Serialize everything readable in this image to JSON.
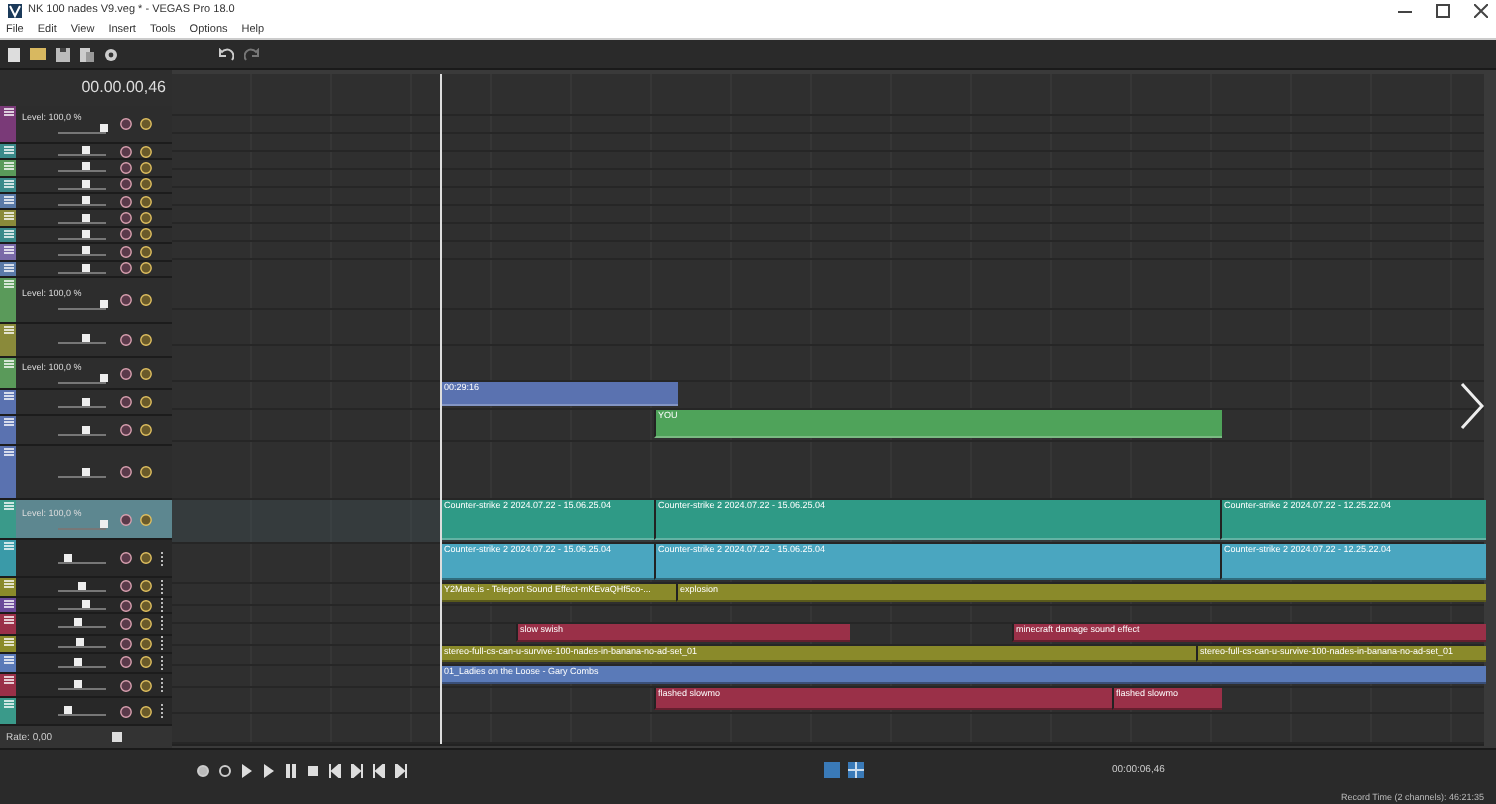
{
  "window": {
    "title": "NK 100 nades V9.veg * - VEGAS Pro 18.0"
  },
  "menu": [
    "File",
    "Edit",
    "View",
    "Insert",
    "Tools",
    "Options",
    "Help"
  ],
  "timecode": "00.00.00,46",
  "tracks": [
    {
      "kind": "video",
      "color": "#7a3a78",
      "level_text": "Level: 100,0 %",
      "level": 0.95,
      "selected": false
    },
    {
      "kind": "video",
      "color": "#3a8a8a",
      "level": 0.6,
      "selected": false
    },
    {
      "kind": "video",
      "color": "#5a9a5a",
      "level": 0.6,
      "selected": false
    },
    {
      "kind": "video",
      "color": "#3a8a8a",
      "level": 0.6,
      "selected": false
    },
    {
      "kind": "video",
      "color": "#5a7aa8",
      "level": 0.6,
      "selected": false
    },
    {
      "kind": "video",
      "color": "#8a8a3a",
      "level": 0.6,
      "selected": false
    },
    {
      "kind": "video",
      "color": "#3a8a8a",
      "level": 0.6,
      "selected": false
    },
    {
      "kind": "video",
      "color": "#7a6aa8",
      "level": 0.6,
      "selected": false
    },
    {
      "kind": "video",
      "color": "#5a7aa8",
      "level": 0.6,
      "selected": false
    },
    {
      "kind": "video",
      "color": "#5a9a5a",
      "level_text": "Level: 100,0 %",
      "level": 0.95,
      "selected": false
    },
    {
      "kind": "video",
      "color": "#8a8a3a",
      "level": 0.6,
      "selected": false
    },
    {
      "kind": "video",
      "color": "#5a9a5a",
      "level_text": "Level: 100,0 %",
      "level": 0.95,
      "selected": false
    },
    {
      "kind": "video",
      "color": "#5a72b0",
      "level": 0.6,
      "selected": false,
      "clips": [
        {
          "label": "00:29:16",
          "color": "#5a72b0"
        }
      ]
    },
    {
      "kind": "video",
      "color": "#5a72b0",
      "level": 0.6,
      "selected": false,
      "clips": [
        {
          "label": "YOU",
          "color": "#4fa35a"
        }
      ]
    },
    {
      "kind": "video",
      "color": "#5a72b0",
      "level": 0.6,
      "selected": false
    },
    {
      "kind": "video",
      "color": "#3a9a8a",
      "level_text": "Level: 100,0 %",
      "level": 0.95,
      "selected": true,
      "clips": [
        {
          "label": "Counter-strike 2 2024.07.22 - 15.06.25.04",
          "color": "#2f9a86"
        },
        {
          "label": "Counter-strike 2 2024.07.22 - 15.06.25.04",
          "color": "#2f9a86"
        },
        {
          "label": "Counter-strike 2 2024.07.22 - 12.25.22.04",
          "color": "#2f9a86"
        }
      ]
    },
    {
      "kind": "audio",
      "color": "#3a9aa8",
      "level": 0.2,
      "selected": false,
      "clips": [
        {
          "label": "Counter-strike 2 2024.07.22 - 15.06.25.04",
          "color": "#4aa6c0"
        },
        {
          "label": "Counter-strike 2 2024.07.22 - 15.06.25.04",
          "color": "#4aa6c0"
        },
        {
          "label": "Counter-strike 2 2024.07.22 - 12.25.22.04",
          "color": "#4aa6c0"
        }
      ]
    },
    {
      "kind": "audio",
      "color": "#8a8a2a",
      "level": 0.5,
      "selected": false,
      "clips": [
        {
          "label": "Y2Mate.is - Teleport Sound Effect-mKEvaQHf5co-...",
          "color": "#8a8a2a"
        },
        {
          "label": "explosion",
          "color": "#8a8a2a"
        }
      ]
    },
    {
      "kind": "audio",
      "color": "#6a4a9a",
      "level": 0.6,
      "selected": false
    },
    {
      "kind": "audio",
      "color": "#9a3048",
      "level": 0.4,
      "selected": false,
      "clips": [
        {
          "label": "slow swish",
          "color": "#9a3048"
        },
        {
          "label": "minecraft damage sound effect",
          "color": "#9a3048"
        }
      ]
    },
    {
      "kind": "audio",
      "color": "#8a8a2a",
      "level": 0.45,
      "selected": false,
      "clips": [
        {
          "label": "stereo-full-cs-can-u-survive-100-nades-in-banana-no-ad-set_01",
          "color": "#8a8a2a"
        },
        {
          "label": "stereo-full-cs-can-u-survive-100-nades-in-banana-no-ad-set_01",
          "color": "#8a8a2a"
        }
      ]
    },
    {
      "kind": "audio",
      "color": "#5a7ab8",
      "level": 0.4,
      "selected": false,
      "clips": [
        {
          "label": "01_Ladies on the Loose - Gary Combs",
          "color": "#5a7ab8"
        }
      ]
    },
    {
      "kind": "audio",
      "color": "#9a3048",
      "level": 0.4,
      "selected": false,
      "clips": [
        {
          "label": "flashed slowmo",
          "color": "#9a3048"
        },
        {
          "label": "flashed slowmo",
          "color": "#9a3048"
        }
      ]
    },
    {
      "kind": "audio",
      "color": "#3a9a8a",
      "level": 0.2,
      "selected": false
    }
  ],
  "rate": "Rate: 0,00",
  "cursor_time": "00:00:06,46",
  "record_time": "Record Time (2 channels): 46:21:35"
}
